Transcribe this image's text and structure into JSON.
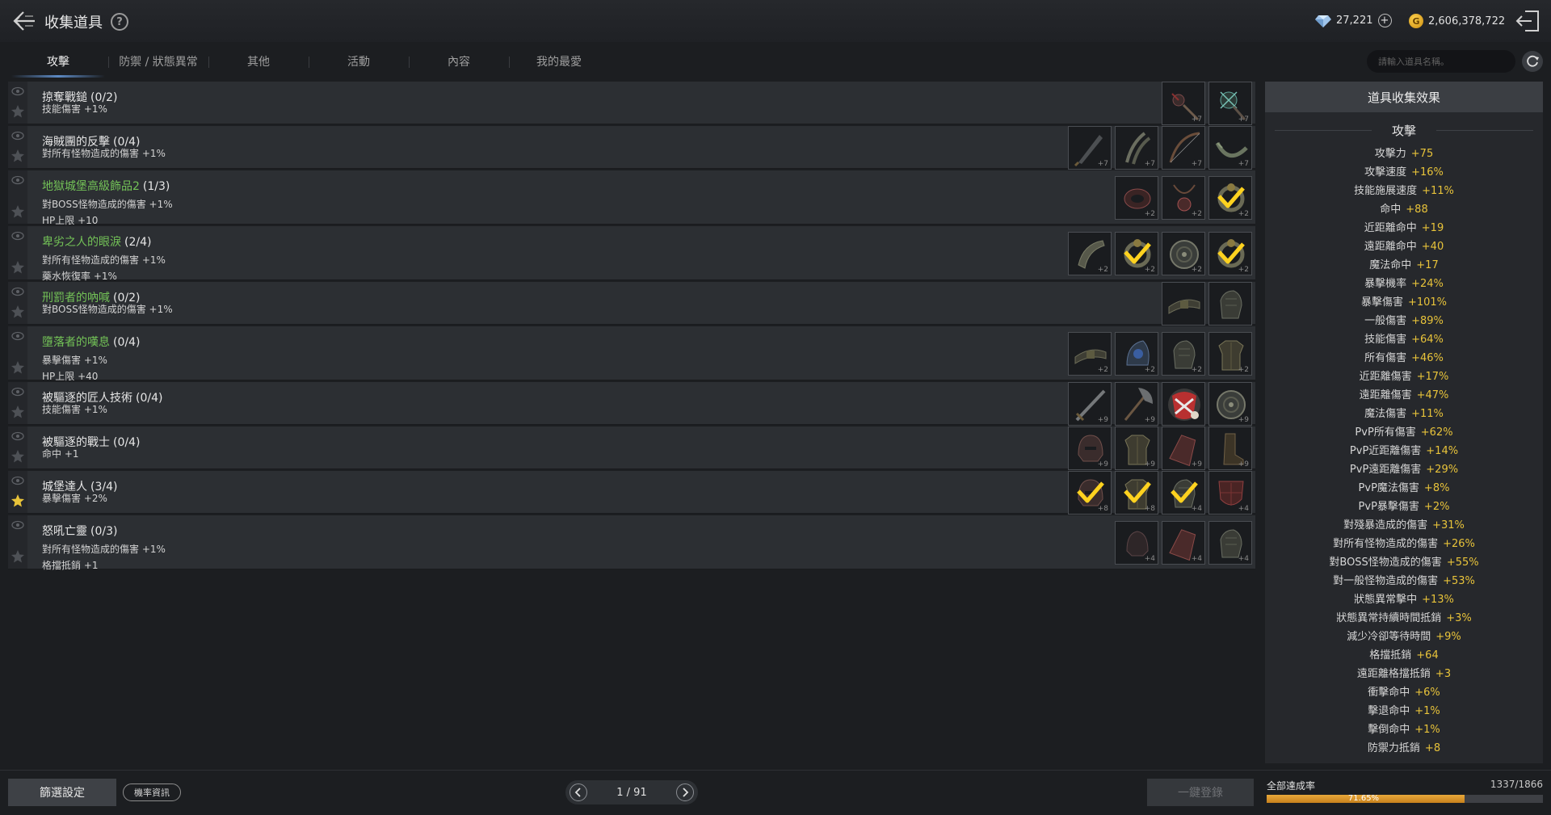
{
  "header": {
    "title": "收集道具",
    "help": "?",
    "gems": "27,221",
    "gold": "2,606,378,722",
    "gold_symbol": "G"
  },
  "tabs": [
    {
      "label": "攻擊",
      "active": true
    },
    {
      "label": "防禦 / 狀態異常",
      "active": false
    },
    {
      "label": "其他",
      "active": false
    },
    {
      "label": "活動",
      "active": false
    },
    {
      "label": "內容",
      "active": false
    },
    {
      "label": "我的最愛",
      "active": false
    }
  ],
  "search": {
    "placeholder": "請輸入道具名稱。"
  },
  "rows": [
    {
      "name": "掠奪戰鎚",
      "highlight": false,
      "count": "(0/2)",
      "effects": [
        "技能傷害 +1%"
      ],
      "favorite": false,
      "slots": [
        {
          "icon": "flail",
          "lvl": "+7",
          "done": false
        },
        {
          "icon": "mace",
          "lvl": "+7",
          "done": false
        }
      ]
    },
    {
      "name": "海賊團的反擊",
      "highlight": false,
      "count": "(0/4)",
      "effects": [
        "對所有怪物造成的傷害 +1%"
      ],
      "favorite": false,
      "slots": [
        {
          "icon": "dagger",
          "lvl": "+7",
          "done": false
        },
        {
          "icon": "claws",
          "lvl": "+7",
          "done": false
        },
        {
          "icon": "bow",
          "lvl": "+7",
          "done": false
        },
        {
          "icon": "chakram",
          "lvl": "+7",
          "done": false
        }
      ]
    },
    {
      "name": "地獄城堡高級飾品2",
      "highlight": true,
      "count": "(1/3)",
      "effects": [
        "對BOSS怪物造成的傷害 +1%",
        "HP上限 +10"
      ],
      "favorite": false,
      "slots": [
        {
          "icon": "bracelet",
          "lvl": "+2",
          "done": false
        },
        {
          "icon": "amulet",
          "lvl": "+2",
          "done": false
        },
        {
          "icon": "ring",
          "lvl": "+2",
          "done": true
        }
      ]
    },
    {
      "name": "卑劣之人的眼淚",
      "highlight": true,
      "count": "(2/4)",
      "effects": [
        "對所有怪物造成的傷害 +1%",
        "藥水恢復率 +1%"
      ],
      "favorite": false,
      "slots": [
        {
          "icon": "horn",
          "lvl": "+2",
          "done": false
        },
        {
          "icon": "ring",
          "lvl": "+2",
          "done": true
        },
        {
          "icon": "shield-round",
          "lvl": "+2",
          "done": false
        },
        {
          "icon": "ring",
          "lvl": "+2",
          "done": true
        }
      ]
    },
    {
      "name": "刑罰者的吶喊",
      "highlight": true,
      "count": "(0/2)",
      "effects": [
        "對BOSS怪物造成的傷害 +1%"
      ],
      "favorite": false,
      "slots": [
        {
          "icon": "belt",
          "lvl": "",
          "done": false
        },
        {
          "icon": "gauntlet",
          "lvl": "",
          "done": false
        }
      ]
    },
    {
      "name": "墮落者的嘆息",
      "highlight": true,
      "count": "(0/4)",
      "effects": [
        "暴擊傷害 +1%",
        "HP上限 +40"
      ],
      "favorite": false,
      "slots": [
        {
          "icon": "belt",
          "lvl": "+2",
          "done": false
        },
        {
          "icon": "gem",
          "lvl": "+2",
          "done": false
        },
        {
          "icon": "gauntlet",
          "lvl": "+2",
          "done": false
        },
        {
          "icon": "armor",
          "lvl": "+2",
          "done": false
        }
      ]
    },
    {
      "name": "被驅逐的匠人技術",
      "highlight": false,
      "count": "(0/4)",
      "effects": [
        "技能傷害 +1%"
      ],
      "favorite": false,
      "slots": [
        {
          "icon": "sword",
          "lvl": "+9",
          "done": false
        },
        {
          "icon": "axe",
          "lvl": "+9",
          "done": false
        },
        {
          "icon": "red-item",
          "lvl": "",
          "done": false
        },
        {
          "icon": "shield-round",
          "lvl": "+9",
          "done": false
        }
      ]
    },
    {
      "name": "被驅逐的戰士",
      "highlight": false,
      "count": "(0/4)",
      "effects": [
        "命中 +1"
      ],
      "favorite": false,
      "slots": [
        {
          "icon": "helmet",
          "lvl": "+9",
          "done": false
        },
        {
          "icon": "armor",
          "lvl": "+9",
          "done": false
        },
        {
          "icon": "bracer",
          "lvl": "+9",
          "done": false
        },
        {
          "icon": "boots",
          "lvl": "+9",
          "done": false
        }
      ]
    },
    {
      "name": "城堡達人",
      "highlight": false,
      "count": "(3/4)",
      "effects": [
        "暴擊傷害 +2%"
      ],
      "favorite": true,
      "slots": [
        {
          "icon": "helmet",
          "lvl": "+8",
          "done": true
        },
        {
          "icon": "armor",
          "lvl": "+8",
          "done": true
        },
        {
          "icon": "gauntlet",
          "lvl": "+4",
          "done": true
        },
        {
          "icon": "red-shield",
          "lvl": "+4",
          "done": false
        }
      ]
    },
    {
      "name": "怒吼亡靈",
      "highlight": false,
      "count": "(0/3)",
      "effects": [
        "對所有怪物造成的傷害 +1%",
        "格擋抵銷 +1"
      ],
      "favorite": false,
      "slots": [
        {
          "icon": "helmet-dark",
          "lvl": "+4",
          "done": false
        },
        {
          "icon": "bracer",
          "lvl": "+4",
          "done": false
        },
        {
          "icon": "gauntlet",
          "lvl": "+4",
          "done": false
        }
      ]
    }
  ],
  "panel": {
    "title": "道具收集效果",
    "section": "攻擊",
    "stats": [
      {
        "label": "攻擊力",
        "value": "+75"
      },
      {
        "label": "攻擊速度",
        "value": "+16%"
      },
      {
        "label": "技能施展速度",
        "value": "+11%"
      },
      {
        "label": "命中",
        "value": "+88"
      },
      {
        "label": "近距離命中",
        "value": "+19"
      },
      {
        "label": "遠距離命中",
        "value": "+40"
      },
      {
        "label": "魔法命中",
        "value": "+17"
      },
      {
        "label": "暴擊機率",
        "value": "+24%"
      },
      {
        "label": "暴擊傷害",
        "value": "+101%"
      },
      {
        "label": "一般傷害",
        "value": "+89%"
      },
      {
        "label": "技能傷害",
        "value": "+64%"
      },
      {
        "label": "所有傷害",
        "value": "+46%"
      },
      {
        "label": "近距離傷害",
        "value": "+17%"
      },
      {
        "label": "遠距離傷害",
        "value": "+47%"
      },
      {
        "label": "魔法傷害",
        "value": "+11%"
      },
      {
        "label": "PvP所有傷害",
        "value": "+62%"
      },
      {
        "label": "PvP近距離傷害",
        "value": "+14%"
      },
      {
        "label": "PvP遠距離傷害",
        "value": "+29%"
      },
      {
        "label": "PvP魔法傷害",
        "value": "+8%"
      },
      {
        "label": "PvP暴擊傷害",
        "value": "+2%"
      },
      {
        "label": "對殘暴造成的傷害",
        "value": "+31%"
      },
      {
        "label": "對所有怪物造成的傷害",
        "value": "+26%"
      },
      {
        "label": "對BOSS怪物造成的傷害",
        "value": "+55%"
      },
      {
        "label": "對一般怪物造成的傷害",
        "value": "+53%"
      },
      {
        "label": "狀態異常擊中",
        "value": "+13%"
      },
      {
        "label": "狀態異常持續時間抵銷",
        "value": "+3%"
      },
      {
        "label": "減少冷卻等待時間",
        "value": "+9%"
      },
      {
        "label": "格擋抵銷",
        "value": "+64"
      },
      {
        "label": "遠距離格擋抵銷",
        "value": "+3"
      },
      {
        "label": "衝擊命中",
        "value": "+6%"
      },
      {
        "label": "擊退命中",
        "value": "+1%"
      },
      {
        "label": "擊倒命中",
        "value": "+1%"
      },
      {
        "label": "防禦力抵銷",
        "value": "+8"
      }
    ]
  },
  "footer": {
    "filter": "篩選設定",
    "rate_info": "機率資訊",
    "page": "1 / 91",
    "register_all": "一鍵登錄",
    "achievement_label": "全部達成率",
    "achievement_count": "1337/1866",
    "achievement_pct_text": "71.65%",
    "achievement_fraction": 0.7165
  },
  "colors": {
    "accent_gold": "#e8c33a",
    "highlight_green": "#73c257",
    "check_yellow": "#ffd21f"
  }
}
